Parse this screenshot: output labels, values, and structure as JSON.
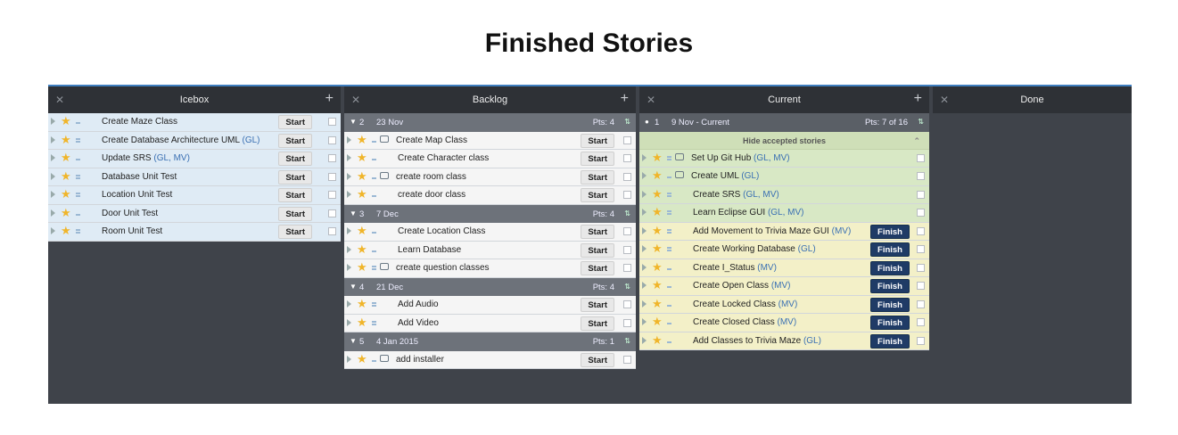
{
  "page": {
    "title": "Finished Stories"
  },
  "colors": {
    "accent": "#3f7fc0",
    "finish": "#1f3b66",
    "star": "#f0b52a"
  },
  "icebox": {
    "title": "Icebox",
    "stories": [
      {
        "name": "Create Maze Class",
        "owners": "",
        "button": "Start"
      },
      {
        "name": "Create Database Architecture UML",
        "owners": "(GL)",
        "button": "Start"
      },
      {
        "name": "Update SRS",
        "owners": "(GL, MV)",
        "button": "Start"
      },
      {
        "name": "Database Unit Test",
        "owners": "",
        "button": "Start"
      },
      {
        "name": "Location Unit Test",
        "owners": "",
        "button": "Start"
      },
      {
        "name": "Door Unit Test",
        "owners": "",
        "button": "Start"
      },
      {
        "name": "Room Unit Test",
        "owners": "",
        "button": "Start"
      }
    ]
  },
  "backlog": {
    "title": "Backlog",
    "iterations": [
      {
        "num": "2",
        "date": "23 Nov",
        "pts": "Pts: 4",
        "stories": [
          {
            "name": "Create Map Class",
            "button": "Start"
          },
          {
            "name": "Create Character class",
            "button": "Start"
          },
          {
            "name": "create room class",
            "button": "Start"
          },
          {
            "name": "create door class",
            "button": "Start"
          }
        ]
      },
      {
        "num": "3",
        "date": "7 Dec",
        "pts": "Pts: 4",
        "stories": [
          {
            "name": "Create Location Class",
            "button": "Start"
          },
          {
            "name": "Learn Database",
            "button": "Start"
          },
          {
            "name": "create question classes",
            "button": "Start"
          }
        ]
      },
      {
        "num": "4",
        "date": "21 Dec",
        "pts": "Pts: 4",
        "stories": [
          {
            "name": "Add Audio",
            "button": "Start"
          },
          {
            "name": "Add Video",
            "button": "Start"
          }
        ]
      },
      {
        "num": "5",
        "date": "4 Jan 2015",
        "pts": "Pts: 1",
        "stories": [
          {
            "name": "add installer",
            "button": "Start"
          }
        ]
      }
    ]
  },
  "current": {
    "title": "Current",
    "iteration": {
      "num": "1",
      "date": "9 Nov - Current",
      "pts": "Pts: 7 of 16"
    },
    "hide_accepted": "Hide accepted stories",
    "accepted": [
      {
        "name": "Set Up Git Hub",
        "owners": "(GL, MV)"
      },
      {
        "name": "Create UML",
        "owners": "(GL)"
      },
      {
        "name": "Create SRS",
        "owners": "(GL, MV)"
      },
      {
        "name": "Learn Eclipse GUI",
        "owners": "(GL, MV)"
      }
    ],
    "started": [
      {
        "name": "Add Movement to Trivia Maze GUI",
        "owners": "(MV)",
        "button": "Finish"
      },
      {
        "name": "Create Working Database",
        "owners": "(GL)",
        "button": "Finish"
      },
      {
        "name": "Create I_Status",
        "owners": "(MV)",
        "button": "Finish"
      },
      {
        "name": "Create Open Class",
        "owners": "(MV)",
        "button": "Finish"
      },
      {
        "name": "Create Locked Class",
        "owners": "(MV)",
        "button": "Finish"
      },
      {
        "name": "Create Closed Class",
        "owners": "(MV)",
        "button": "Finish"
      },
      {
        "name": "Add Classes to Trivia Maze",
        "owners": "(GL)",
        "button": "Finish"
      }
    ]
  },
  "done": {
    "title": "Done"
  }
}
